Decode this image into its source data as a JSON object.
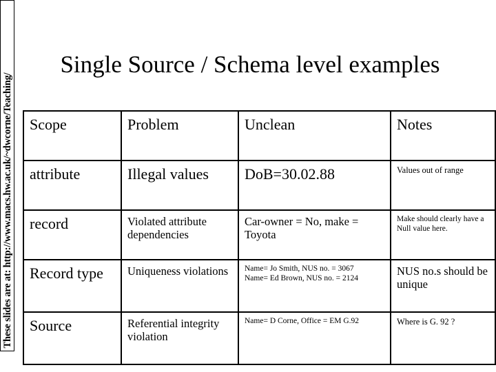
{
  "sidebar": {
    "note": "These slides are at: http://www.macs.hw.ac.uk/~dwcorne/Teaching/"
  },
  "slide": {
    "title": "Single Source / Schema level examples"
  },
  "table": {
    "headers": {
      "scope": "Scope",
      "problem": "Problem",
      "unclean": "Unclean",
      "notes": "Notes"
    },
    "rows": [
      {
        "scope": "attribute",
        "problem": "Illegal values",
        "unclean": "DoB=30.02.88",
        "notes": "Values out of range"
      },
      {
        "scope": "record",
        "problem": "Violated attribute dependencies",
        "unclean": "Car-owner = No, make = Toyota",
        "notes": "Make should clearly have a Null value here."
      },
      {
        "scope": "Record type",
        "problem": "Uniqueness violations",
        "unclean_line1": "Name= Jo Smith, NUS no. = 3067",
        "unclean_line2": "Name= Ed Brown, NUS no. = 2124",
        "notes": "NUS no.s should be unique"
      },
      {
        "scope": "Source",
        "problem": "Referential integrity violation",
        "unclean": "Name= D Corne, Office = EM G.92",
        "notes": "Where is G. 92 ?"
      }
    ]
  },
  "colors": {
    "background": "#ffffff",
    "text": "#000000",
    "border": "#000000"
  }
}
